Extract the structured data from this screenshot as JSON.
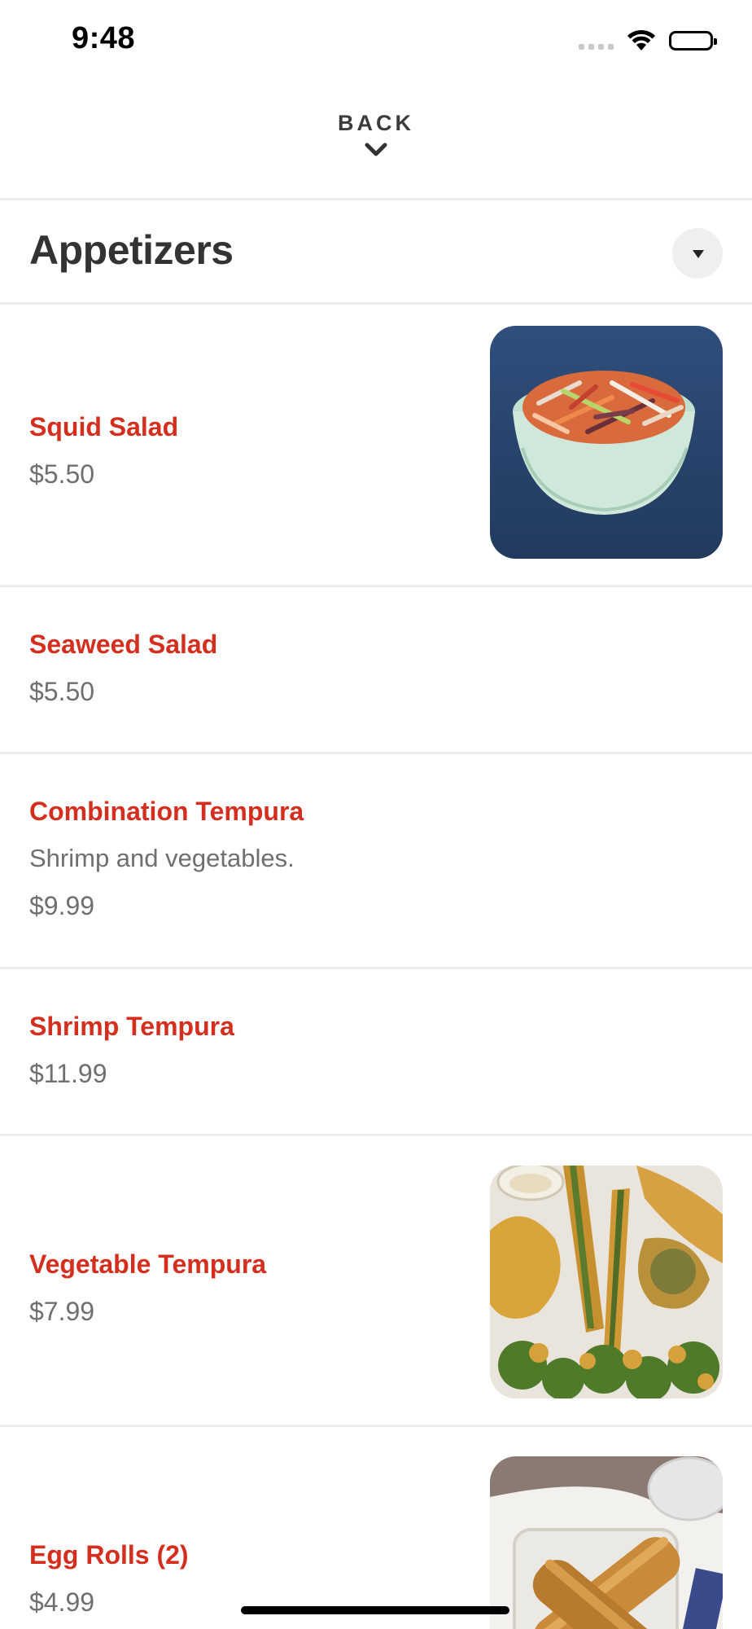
{
  "status_bar": {
    "time": "9:48"
  },
  "navigation": {
    "back_label": "BACK"
  },
  "section": {
    "title": "Appetizers"
  },
  "items": [
    {
      "name": "Squid Salad",
      "price": "$5.50",
      "photo": "squid-salad-photo"
    },
    {
      "name": "Seaweed Salad",
      "price": "$5.50"
    },
    {
      "name": "Combination Tempura",
      "description": "Shrimp and vegetables.",
      "price": "$9.99"
    },
    {
      "name": "Shrimp Tempura",
      "price": "$11.99"
    },
    {
      "name": "Vegetable Tempura",
      "price": "$7.99",
      "photo": "vegetable-tempura-photo"
    },
    {
      "name": "Egg Rolls (2)",
      "price": "$4.99",
      "photo": "egg-rolls-photo"
    }
  ],
  "colors": {
    "item_name": "#d42f1e",
    "secondary_text": "#6f6f6f",
    "heading": "#333333",
    "divider": "#ececec"
  }
}
